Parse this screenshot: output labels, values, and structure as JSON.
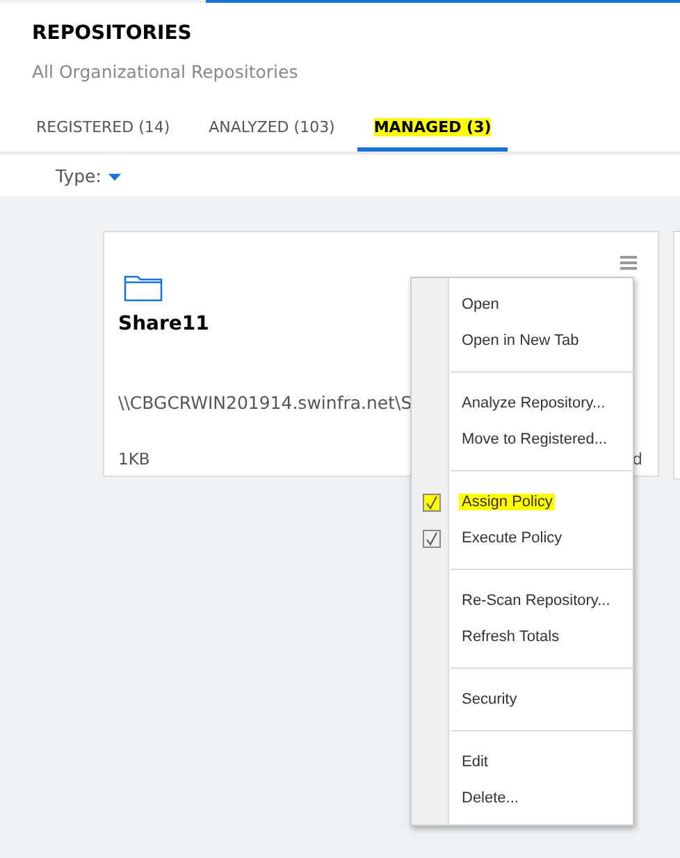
{
  "header": {
    "title": "REPOSITORIES",
    "subtitle": "All Organizational Repositories"
  },
  "tabs": [
    {
      "label": "REGISTERED (14)",
      "selected": false,
      "highlighted": false
    },
    {
      "label": "ANALYZED (103)",
      "selected": false,
      "highlighted": false
    },
    {
      "label": "MANAGED (3)",
      "selected": true,
      "highlighted": true
    }
  ],
  "filter": {
    "label": "Type:"
  },
  "card": {
    "name": "Share11",
    "path": "\\\\CBGCRWIN201914.swinfra.net\\S",
    "size": "1KB",
    "status": "d"
  },
  "menu": {
    "groups": [
      [
        {
          "label": "Open",
          "kind": "plain"
        },
        {
          "label": "Open in New Tab",
          "kind": "plain"
        }
      ],
      [
        {
          "label": "Analyze Repository...",
          "kind": "plain"
        },
        {
          "label": "Move to Registered...",
          "kind": "plain"
        }
      ],
      [
        {
          "label": "Assign Policy",
          "kind": "check",
          "checked": true,
          "highlighted": true
        },
        {
          "label": "Execute Policy",
          "kind": "check",
          "checked": true,
          "highlighted": false
        }
      ],
      [
        {
          "label": "Re-Scan Repository...",
          "kind": "plain"
        },
        {
          "label": "Refresh Totals",
          "kind": "plain"
        }
      ],
      [
        {
          "label": "Security",
          "kind": "plain"
        }
      ],
      [
        {
          "label": "Edit",
          "kind": "plain"
        },
        {
          "label": "Delete...",
          "kind": "plain"
        }
      ]
    ]
  }
}
